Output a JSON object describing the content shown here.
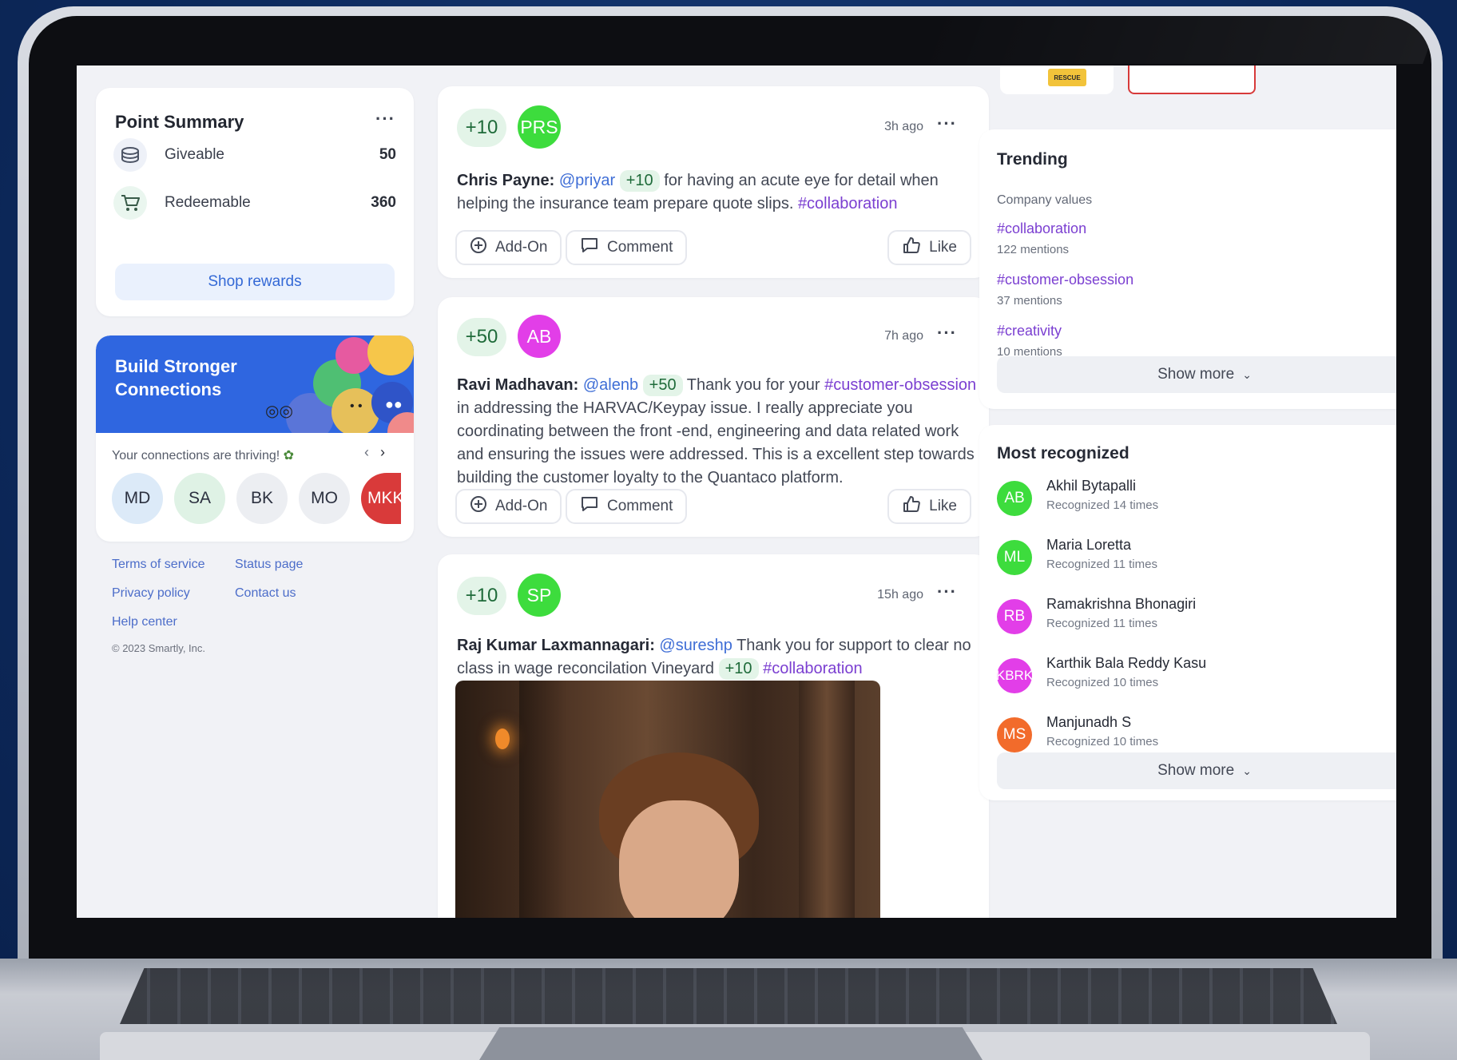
{
  "point_summary": {
    "title": "Point Summary",
    "more": "···",
    "rows": [
      {
        "label": "Giveable",
        "value": "50",
        "icon": "coins-icon"
      },
      {
        "label": "Redeemable",
        "value": "360",
        "icon": "cart-icon"
      }
    ],
    "shop_label": "Shop rewards"
  },
  "connections": {
    "title": "Build Stronger Connections",
    "subtitle": "Your connections are thriving!",
    "prev": "‹",
    "next": "›",
    "avatars": [
      {
        "initials": "MD",
        "bg": "#dceaf8"
      },
      {
        "initials": "SA",
        "bg": "#dff2e5"
      },
      {
        "initials": "BK",
        "bg": "#eceef2"
      },
      {
        "initials": "MO",
        "bg": "#eceef2"
      },
      {
        "initials": "MKK",
        "bg": "#d93a3a"
      }
    ]
  },
  "footer": {
    "links": [
      "Terms of service",
      "Status page",
      "Privacy policy",
      "Contact us",
      "Help center"
    ],
    "copyright": "© 2023 Smartly, Inc."
  },
  "posts": [
    {
      "points": "+10",
      "avatar": "PRS",
      "avatar_color": "#3ddc3d",
      "time": "3h ago",
      "author": "Chris Payne:",
      "mention": "@priyar",
      "inline_points": "+10",
      "text_a": " for having an acute eye for detail when helping the insurance team prepare quote slips. ",
      "tag": "#collaboration"
    },
    {
      "points": "+50",
      "avatar": "AB",
      "avatar_color": "#e23ee8",
      "time": "7h ago",
      "author": "Ravi Madhavan:",
      "mention": "@alenb",
      "inline_points": "+50",
      "text_a": " Thank you for your ",
      "tag": "#customer-obsession",
      "text_b": " in addressing the HARVAC/Keypay issue. I really appreciate you coordinating between the front -end, engineering and data related work and ensuring the issues were addressed. This is a excellent step towards building the customer loyalty to the Quantaco platform."
    },
    {
      "points": "+10",
      "avatar": "SP",
      "avatar_color": "#3ddc3d",
      "time": "15h ago",
      "author": "Raj Kumar Laxmannagari:",
      "mention": "@sureshp",
      "text_a": " Thank you for support to clear no class in wage reconcilation Vineyard ",
      "inline_points": "+10",
      "tag": "#collaboration"
    }
  ],
  "actions": {
    "addon": "Add-On",
    "comment": "Comment",
    "like": "Like"
  },
  "trending": {
    "title": "Trending",
    "subtitle": "Company values",
    "items": [
      {
        "tag": "#collaboration",
        "mentions": "122 mentions"
      },
      {
        "tag": "#customer-obsession",
        "mentions": "37 mentions"
      },
      {
        "tag": "#creativity",
        "mentions": "10 mentions"
      }
    ],
    "show_more": "Show more"
  },
  "most_recognized": {
    "title": "Most recognized",
    "people": [
      {
        "initials": "AB",
        "name": "Akhil Bytapalli",
        "count": "Recognized 14 times",
        "color": "#3ddc3d"
      },
      {
        "initials": "ML",
        "name": "Maria Loretta",
        "count": "Recognized 11 times",
        "color": "#3ddc3d"
      },
      {
        "initials": "RB",
        "name": "Ramakrishna Bhonagiri",
        "count": "Recognized 11 times",
        "color": "#e23ee8"
      },
      {
        "initials": "KBRK",
        "name": "Karthik Bala Reddy Kasu",
        "count": "Recognized 10 times",
        "color": "#e23ee8"
      },
      {
        "initials": "MS",
        "name": "Manjunadh S",
        "count": "Recognized 10 times",
        "color": "#f26b2b"
      }
    ],
    "show_more": "Show more"
  },
  "top_strip": {
    "logo_text": "RESCUE"
  }
}
